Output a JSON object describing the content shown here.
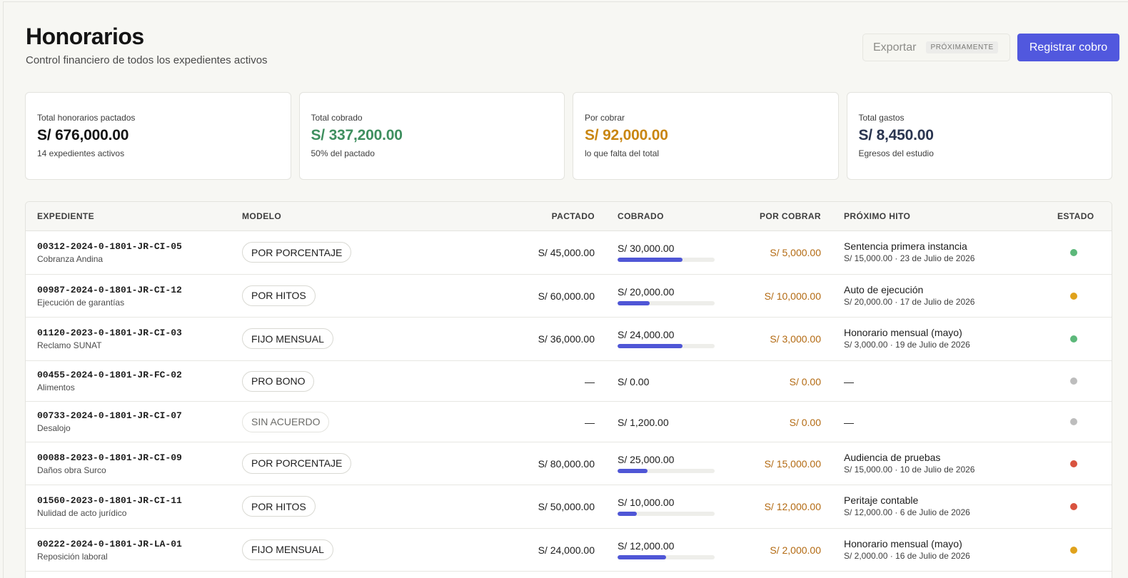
{
  "header": {
    "title": "Honorarios",
    "subtitle": "Control financiero de todos los expedientes activos",
    "export_label": "Exportar",
    "export_tag": "PRÓXIMAMENTE",
    "primary_label": "Registrar cobro"
  },
  "cards": [
    {
      "label": "Total honorarios pactados",
      "value": "S/ 676,000.00",
      "sub": "14 expedientes activos",
      "color": "#141414"
    },
    {
      "label": "Total cobrado",
      "value": "S/ 337,200.00",
      "sub": "50% del pactado",
      "color": "#3f8f5f"
    },
    {
      "label": "Por cobrar",
      "value": "S/ 92,000.00",
      "sub": "lo que falta del total",
      "color": "#c98611"
    },
    {
      "label": "Total gastos",
      "value": "S/ 8,450.00",
      "sub": "Egresos del estudio",
      "color": "#2a3550"
    }
  ],
  "table": {
    "headers": {
      "expediente": "EXPEDIENTE",
      "modelo": "MODELO",
      "pactado": "PACTADO",
      "cobrado": "COBRADO",
      "por_cobrar": "POR COBRAR",
      "hito": "PRÓXIMO HITO",
      "estado": "ESTADO"
    },
    "rows": [
      {
        "code": "00312-2024-0-1801-JR-CI-05",
        "name": "Cobranza Andina",
        "modelo": "POR PORCENTAJE",
        "pactado": "S/ 45,000.00",
        "cobrado": "S/ 30,000.00",
        "progress": 0.67,
        "por_cobrar": "S/ 5,000.00",
        "hito": "Sentencia primera instancia",
        "hito_sub": "S/ 15,000.00 · 23 de Julio de 2026",
        "estado_color": "#5cb87a"
      },
      {
        "code": "00987-2024-0-1801-JR-CI-12",
        "name": "Ejecución de garantías",
        "modelo": "POR HITOS",
        "pactado": "S/ 60,000.00",
        "cobrado": "S/ 20,000.00",
        "progress": 0.33,
        "por_cobrar": "S/ 10,000.00",
        "hito": "Auto de ejecución",
        "hito_sub": "S/ 20,000.00 · 17 de Julio de 2026",
        "estado_color": "#e0a21c"
      },
      {
        "code": "01120-2023-0-1801-JR-CI-03",
        "name": "Reclamo SUNAT",
        "modelo": "FIJO MENSUAL",
        "pactado": "S/ 36,000.00",
        "cobrado": "S/ 24,000.00",
        "progress": 0.67,
        "por_cobrar": "S/ 3,000.00",
        "hito": "Honorario mensual (mayo)",
        "hito_sub": "S/ 3,000.00 · 19 de Julio de 2026",
        "estado_color": "#5cb87a"
      },
      {
        "code": "00455-2024-0-1801-JR-FC-02",
        "name": "Alimentos",
        "modelo": "PRO BONO",
        "pactado": "—",
        "cobrado": "S/ 0.00",
        "progress": null,
        "por_cobrar": "S/ 0.00",
        "hito": "—",
        "hito_sub": "",
        "estado_color": "#bdbdbd"
      },
      {
        "code": "00733-2024-0-1801-JR-CI-07",
        "name": "Desalojo",
        "modelo": "SIN ACUERDO",
        "modelo_muted": true,
        "pactado": "—",
        "cobrado": "S/ 1,200.00",
        "progress": null,
        "por_cobrar": "S/ 0.00",
        "hito": "—",
        "hito_sub": "",
        "estado_color": "#bdbdbd"
      },
      {
        "code": "00088-2023-0-1801-JR-CI-09",
        "name": "Daños obra Surco",
        "modelo": "POR PORCENTAJE",
        "pactado": "S/ 80,000.00",
        "cobrado": "S/ 25,000.00",
        "progress": 0.31,
        "por_cobrar": "S/ 15,000.00",
        "hito": "Audiencia de pruebas",
        "hito_sub": "S/ 15,000.00 · 10 de Julio de 2026",
        "estado_color": "#d9533f"
      },
      {
        "code": "01560-2023-0-1801-JR-CI-11",
        "name": "Nulidad de acto jurídico",
        "modelo": "POR HITOS",
        "pactado": "S/ 50,000.00",
        "cobrado": "S/ 10,000.00",
        "progress": 0.2,
        "por_cobrar": "S/ 12,000.00",
        "hito": "Peritaje contable",
        "hito_sub": "S/ 12,000.00 · 6 de Julio de 2026",
        "estado_color": "#d9533f"
      },
      {
        "code": "00222-2024-0-1801-JR-LA-01",
        "name": "Reposición laboral",
        "modelo": "FIJO MENSUAL",
        "pactado": "S/ 24,000.00",
        "cobrado": "S/ 12,000.00",
        "progress": 0.5,
        "por_cobrar": "S/ 2,000.00",
        "hito": "Honorario mensual (mayo)",
        "hito_sub": "S/ 2,000.00 · 16 de Julio de 2026",
        "estado_color": "#e0a21c"
      }
    ]
  }
}
